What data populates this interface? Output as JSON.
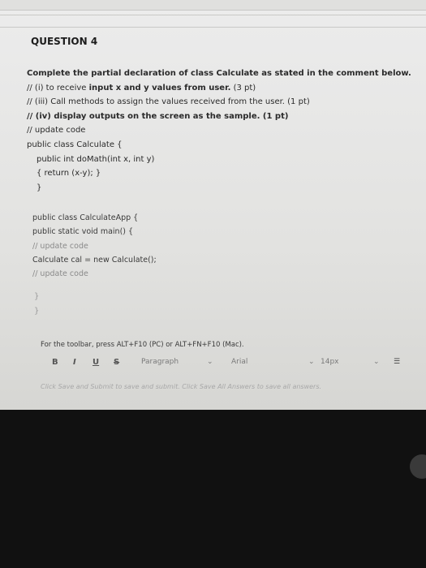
{
  "question": {
    "title": "QUESTION 4",
    "prompt": "Complete the partial declaration of class Calculate as stated in the comment below.",
    "req1_prefix": "// (i) to receive ",
    "req1_bold": "input x and  y values from user.",
    "req1_suffix": " (3 pt)",
    "req2": "// (iii) Call methods to assign the values received from the user. (1 pt)",
    "req3_bold": "// (iv)  display outputs on the screen as the sample.",
    "req3_suffix": " (1 pt)",
    "code1": [
      "// update code",
      "public class Calculate {",
      "public int doMath(int  x, int y)",
      "{  return (x-y); }",
      "}"
    ],
    "code2": [
      "public class CalculateApp {",
      "public static void main() {",
      "// update code",
      "Calculate cal = new Calculate();",
      "// update code"
    ],
    "brace_a": "}",
    "brace_b": "}"
  },
  "editor": {
    "toolbar_hint": "For the toolbar, press ALT+F10 (PC) or ALT+FN+F10 (Mac).",
    "bold": "B",
    "italic": "I",
    "underline": "U",
    "strike": "S",
    "paragraph": "Paragraph",
    "font": "Arial",
    "size": "14px",
    "list_icon": "list-icon"
  },
  "footer": "Click Save and Submit to save and submit. Click Save All Answers to save all answers."
}
